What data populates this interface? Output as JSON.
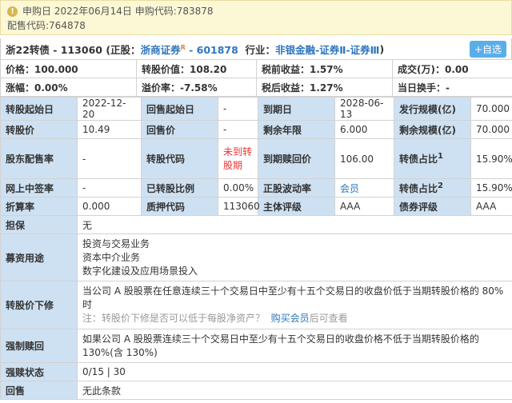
{
  "notice": {
    "line1": "申购日 2022年06月14日 申购代码:783878",
    "line2": "配售代码:764878"
  },
  "header": {
    "bond_name": "浙22转债 - 113060",
    "stock_prefix": "(正股：",
    "stock_name": "浙商证券",
    "stock_mark": "R",
    "stock_code": " - 601878",
    "industry_prefix": "行业：",
    "industry": "非银金融-证券Ⅱ-证券Ⅲ",
    "suffix": ")",
    "add_label": "+自选"
  },
  "quote": {
    "price": "价格：100.000",
    "conv_value": "转股价值：108.20",
    "pretax_yield": "税前收益：1.57%",
    "volume": "成交(万)：0.00",
    "change": "涨幅：0.00%",
    "premium": "溢价率：-7.58%",
    "aftertax_yield": "税后收益：1.27%",
    "turnover": "当日换手：-"
  },
  "details": {
    "conv_start_lbl": "转股起始日",
    "conv_start": "2022-12-20",
    "putback_start_lbl": "回售起始日",
    "putback_start": "-",
    "maturity_lbl": "到期日",
    "maturity": "2028-06-13",
    "issue_size_lbl": "发行规模(亿)",
    "issue_size": "70.000",
    "conv_price_lbl": "转股价",
    "conv_price": "10.49",
    "putback_price_lbl": "回售价",
    "putback_price": "-",
    "remaining_years_lbl": "剩余年限",
    "remaining_years": "6.000",
    "remaining_size_lbl": "剩余规模(亿)",
    "remaining_size": "70.000",
    "holder_ratio_lbl": "股东配售率",
    "holder_ratio": "-",
    "conv_code_lbl": "转股代码",
    "conv_code": "未到转股期",
    "redeem_price_lbl": "到期赎回价",
    "redeem_price": "106.00",
    "bond_ratio1_lbl": "转债占比",
    "bond_ratio1_sup": "1",
    "bond_ratio1": "15.90%",
    "online_rate_lbl": "网上中签率",
    "online_rate": "-",
    "converted_lbl": "已转股比例",
    "converted": "0.00%",
    "volatility_lbl": "正股波动率",
    "volatility": "会员",
    "bond_ratio2_lbl": "转债占比",
    "bond_ratio2_sup": "2",
    "bond_ratio2": "15.90%",
    "discount_lbl": "折算率",
    "discount": "0.000",
    "pledge_code_lbl": "质押代码",
    "pledge_code": "113060",
    "main_rating_lbl": "主体评级",
    "main_rating": "AAA",
    "bond_rating_lbl": "债券评级",
    "bond_rating": "AAA",
    "guarantee_lbl": "担保",
    "guarantee": "无",
    "use_lbl": "募资用途",
    "use1": "投资与交易业务",
    "use2": "资本中介业务",
    "use3": "数字化建设及应用场景投入",
    "reset_lbl": "转股价下修",
    "reset_text": "当公司 A 股股票在任意连续三十个交易日中至少有十五个交易日的收盘价低于当期转股价格的 80%时",
    "reset_note": "注：转股价下修是否可以低于每股净资产？",
    "reset_link": "购买会员",
    "reset_after": "后可查看",
    "force_lbl": "强制赎回",
    "force_text": "如果公司 A 股股票连续三十个交易日中至少有十五个交易日的收盘价格不低于当期转股价格的 130%(含 130%)",
    "force_status_lbl": "强赎状态",
    "force_status": "0/15 | 30",
    "putback_lbl": "回售",
    "putback": "无此条款"
  }
}
